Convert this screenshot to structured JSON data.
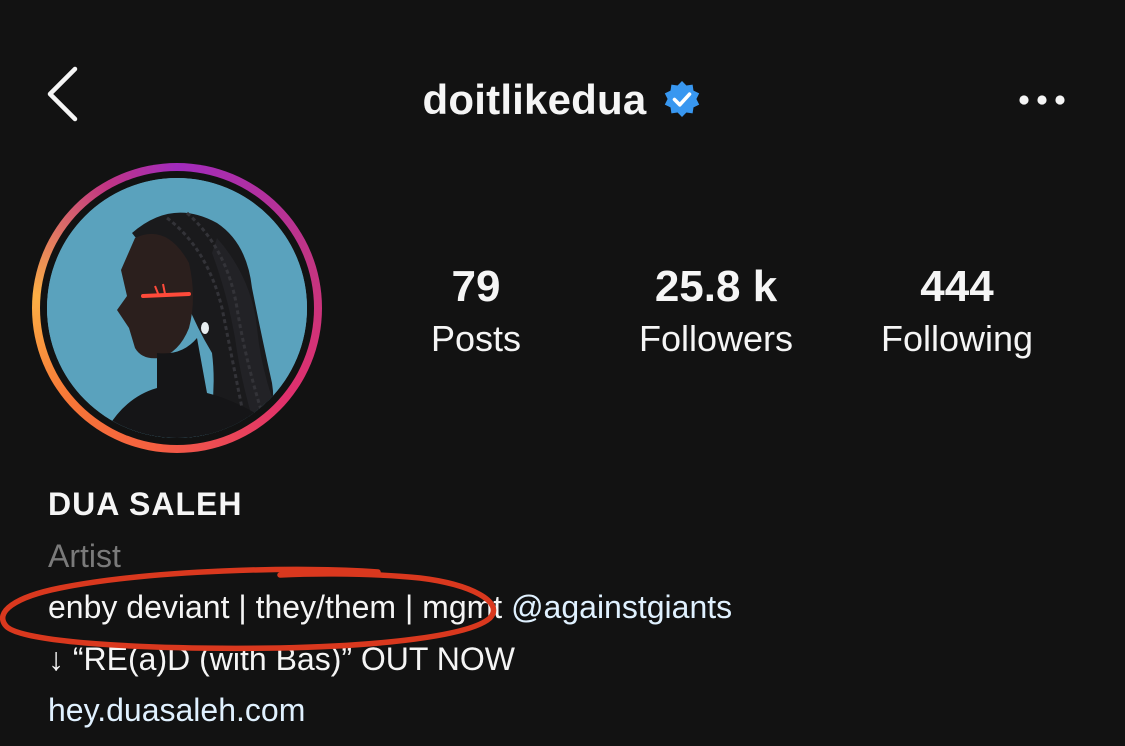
{
  "header": {
    "username": "doitlikedua",
    "back_icon": "chevron-left-icon",
    "verified_icon": "verified-badge-icon",
    "more_icon": "more-horizontal-icon"
  },
  "stats": {
    "posts": {
      "value": "79",
      "label": "Posts"
    },
    "followers": {
      "value": "25.8 k",
      "label": "Followers"
    },
    "following": {
      "value": "444",
      "label": "Following"
    }
  },
  "profile": {
    "display_name": "DUA SALEH",
    "category": "Artist",
    "bio_line1_text": "enby deviant | they/them | mgmt ",
    "bio_line1_mention": "@againstgiants",
    "bio_line2": "↓ “RE(a)D (with Bas)” OUT NOW",
    "website": "hey.duasaleh.com"
  },
  "colors": {
    "background": "#121212",
    "text": "#f5f5f5",
    "muted": "#7a7a7a",
    "link": "#e0f1ff",
    "verified_blue": "#3897f0",
    "annotation_red": "#d9381e"
  }
}
